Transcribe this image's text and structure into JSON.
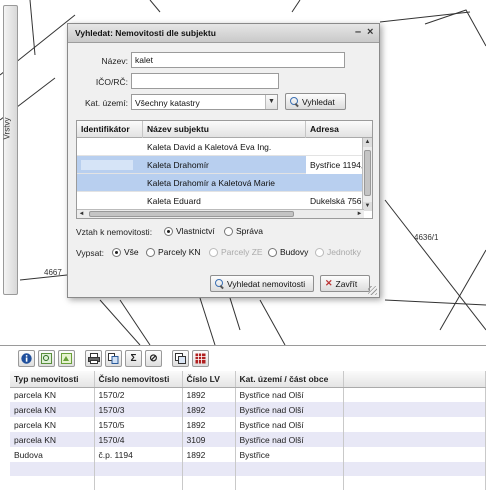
{
  "map": {
    "layers_tab": "Vrstvy",
    "parcel_labels": [
      "4636/1",
      "4667"
    ]
  },
  "dialog": {
    "title": "Vyhledat: Nemovitosti dle subjektu",
    "minimize_glyph": "–",
    "close_glyph": "×",
    "name_label": "Název:",
    "name_value": "kalet",
    "ico_label": "IČO/RČ:",
    "ico_value": "",
    "kat_label": "Kat. území:",
    "kat_value": "Všechny katastry",
    "search_button": "Vyhledat",
    "grid": {
      "columns": [
        "Identifikátor",
        "Název subjektu",
        "Adresa"
      ],
      "rows": [
        {
          "id": "",
          "name": "Kaleta David a Kaletová Eva Ing.",
          "address": "",
          "selected": false
        },
        {
          "id": "",
          "name": "Kaleta Drahomír",
          "address": "Bystřice 1194,",
          "selected": true
        },
        {
          "id": "",
          "name": "Kaleta Drahomír a Kaletová Marie",
          "address": "",
          "selected": true
        },
        {
          "id": "",
          "name": "Kaleta Eduard",
          "address": "Dukelská 756,",
          "selected": false
        }
      ]
    },
    "relation_label": "Vztah k nemovitosti:",
    "relation_options": [
      {
        "label": "Vlastnictví",
        "checked": true
      },
      {
        "label": "Správa",
        "checked": false
      }
    ],
    "list_label": "Vypsat:",
    "list_options": [
      {
        "label": "Vše",
        "checked": true,
        "disabled": false
      },
      {
        "label": "Parcely KN",
        "checked": false,
        "disabled": false
      },
      {
        "label": "Parcely ZE",
        "checked": false,
        "disabled": true
      },
      {
        "label": "Budovy",
        "checked": false,
        "disabled": false
      },
      {
        "label": "Jednotky",
        "checked": false,
        "disabled": true
      }
    ],
    "find_button": "Vyhledat nemovitosti",
    "close_button": "Zavřít"
  },
  "toolbar": {
    "icons": [
      "info-icon",
      "zoom-to-icon",
      "select-map-icon",
      "print-icon",
      "export-icon",
      "sum-icon",
      "clear-icon",
      "copy-icon",
      "table-icon"
    ]
  },
  "table": {
    "columns": [
      "Typ nemovitosti",
      "Číslo nemovitosti",
      "Číslo LV",
      "Kat. území / část obce"
    ],
    "rows": [
      [
        "parcela KN",
        "1570/2",
        "1892",
        "Bystřice nad Olší"
      ],
      [
        "parcela KN",
        "1570/3",
        "1892",
        "Bystřice nad Olší"
      ],
      [
        "parcela KN",
        "1570/5",
        "1892",
        "Bystřice nad Olší"
      ],
      [
        "parcela KN",
        "1570/4",
        "3109",
        "Bystřice nad Olší"
      ],
      [
        "Budova",
        "č.p. 1194",
        "1892",
        "Bystřice"
      ]
    ]
  },
  "colors": {
    "selected_row": "#b8cfef",
    "alt_row": "#e8e8f6",
    "info_icon": "#1f4f9c",
    "table_icon": "#b02020"
  }
}
